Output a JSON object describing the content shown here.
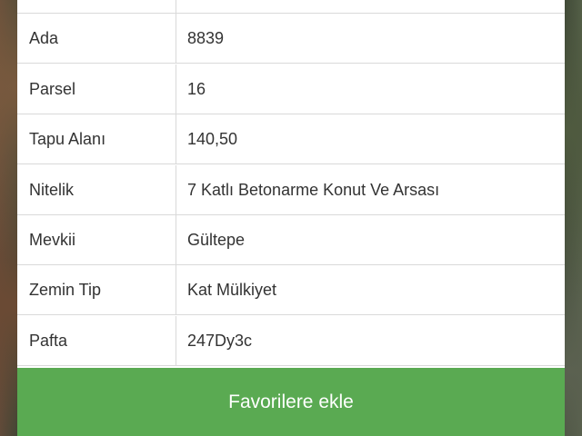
{
  "details": {
    "rows": [
      {
        "label": "",
        "value": ""
      },
      {
        "label": "Ada",
        "value": "8839"
      },
      {
        "label": "Parsel",
        "value": "16"
      },
      {
        "label": "Tapu Alanı",
        "value": "140,50"
      },
      {
        "label": "Nitelik",
        "value": "7 Katlı Betonarme Konut Ve Arsası"
      },
      {
        "label": "Mevkii",
        "value": "Gültepe"
      },
      {
        "label": "Zemin Tip",
        "value": "Kat Mülkiyet"
      },
      {
        "label": "Pafta",
        "value": "247Dy3c"
      }
    ]
  },
  "actions": {
    "favorite_label": "Favorilere ekle"
  },
  "colors": {
    "button": "#5aaa52",
    "border": "#d9d9d9"
  }
}
